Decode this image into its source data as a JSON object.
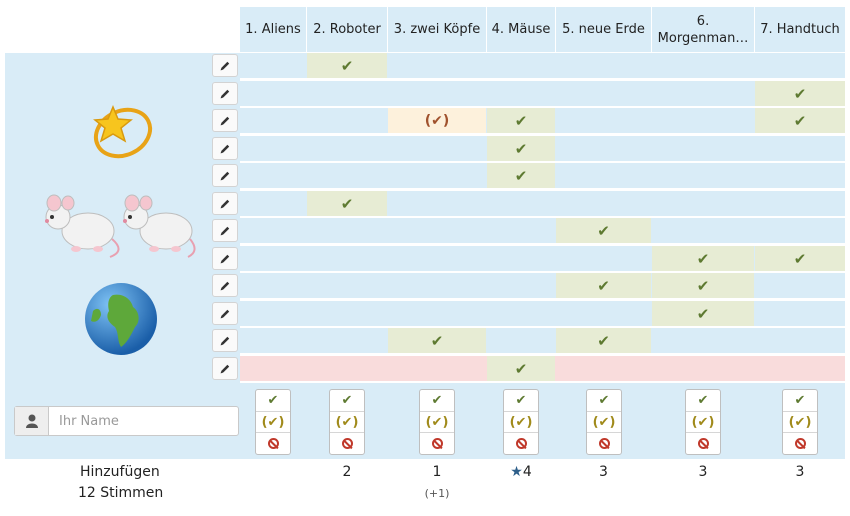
{
  "options": [
    {
      "label": "1. Aliens",
      "count": "",
      "sub": ""
    },
    {
      "label": "2. Roboter",
      "count": "2",
      "sub": ""
    },
    {
      "label": "3. zwei Köpfe",
      "count": "1",
      "sub": "(+1)"
    },
    {
      "label": "4. Mäuse",
      "count": "4",
      "sub": "",
      "winner": true
    },
    {
      "label": "5. neue Erde",
      "count": "3",
      "sub": ""
    },
    {
      "label_line1": "6.",
      "label_line2": "Morgenman…",
      "count": "3",
      "sub": ""
    },
    {
      "label": "7. Handtuch",
      "count": "3",
      "sub": ""
    }
  ],
  "rows": [
    [
      "",
      "yes",
      "",
      "",
      "",
      "",
      ""
    ],
    [
      "",
      "",
      "",
      "",
      "",
      "",
      "yes"
    ],
    [
      "",
      "",
      "maybe",
      "yes",
      "",
      "",
      "yes"
    ],
    [
      "",
      "",
      "",
      "yes",
      "",
      "",
      ""
    ],
    [
      "",
      "",
      "",
      "yes",
      "",
      "",
      ""
    ],
    [
      "",
      "yes",
      "",
      "",
      "",
      "",
      ""
    ],
    [
      "",
      "",
      "",
      "",
      "yes",
      "",
      ""
    ],
    [
      "",
      "",
      "",
      "",
      "",
      "yes",
      "yes"
    ],
    [
      "",
      "",
      "",
      "",
      "yes",
      "yes",
      ""
    ],
    [
      "",
      "",
      "",
      "",
      "",
      "yes",
      ""
    ],
    [
      "",
      "",
      "yes",
      "",
      "yes",
      "",
      ""
    ],
    [
      "",
      "",
      "",
      "yes",
      "",
      "",
      ""
    ]
  ],
  "row_bg_highlight_index": 11,
  "marks": {
    "yes": "✔",
    "maybe": "(✔)"
  },
  "emojis": {
    "star": "shooting-star-emoji",
    "mice": "two-mice-emoji",
    "earth": "globe-emoji"
  },
  "form": {
    "name_placeholder": "Ihr Name",
    "add_label": "Hinzufügen",
    "votes_label": "12 Stimmen"
  },
  "colors": {
    "panel": "#d9ecf7",
    "yes_bg": "#e7ecd4",
    "maybe_bg": "#fdf1dc",
    "highlight_row": "#f9dcdc",
    "check": "#5e7a31"
  }
}
